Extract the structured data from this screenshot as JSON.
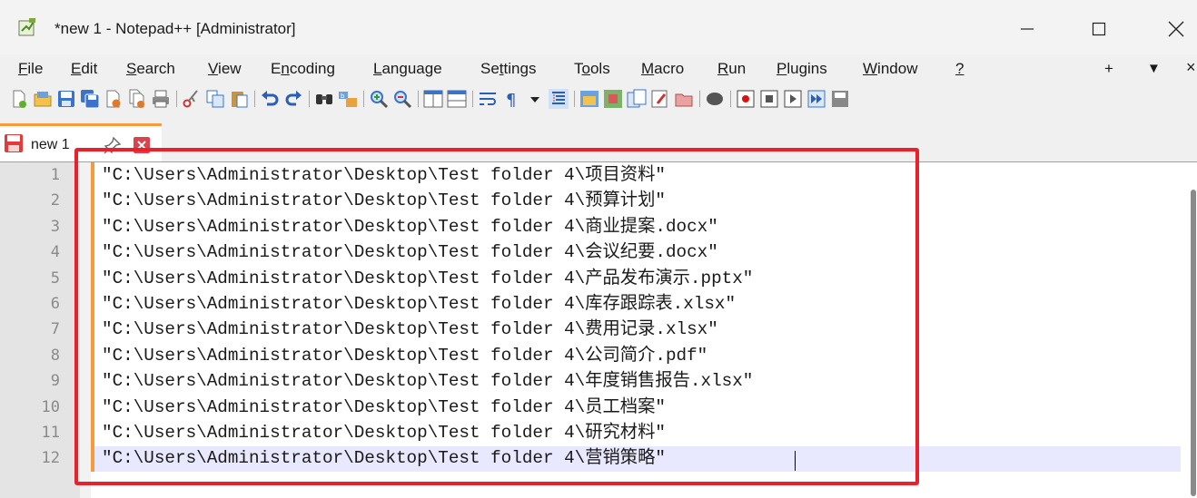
{
  "window": {
    "title": "*new 1 - Notepad++ [Administrator]",
    "icons": [
      "app-icon",
      "minimize-icon",
      "maximize-icon",
      "close-icon"
    ]
  },
  "menubar": {
    "items": [
      {
        "pre": "",
        "key": "F",
        "post": "ile"
      },
      {
        "pre": "",
        "key": "E",
        "post": "dit"
      },
      {
        "pre": "",
        "key": "S",
        "post": "earch"
      },
      {
        "pre": "",
        "key": "V",
        "post": "iew"
      },
      {
        "pre": "E",
        "key": "n",
        "post": "coding"
      },
      {
        "pre": "",
        "key": "L",
        "post": "anguage"
      },
      {
        "pre": "Se",
        "key": "t",
        "post": "tings"
      },
      {
        "pre": "T",
        "key": "o",
        "post": "ols"
      },
      {
        "pre": "",
        "key": "M",
        "post": "acro"
      },
      {
        "pre": "",
        "key": "R",
        "post": "un"
      },
      {
        "pre": "",
        "key": "P",
        "post": "lugins"
      },
      {
        "pre": "",
        "key": "W",
        "post": "indow"
      },
      {
        "pre": "",
        "key": "?",
        "post": ""
      }
    ],
    "right": {
      "plus": "+",
      "down": "▼",
      "close": "×"
    }
  },
  "toolbar": {
    "buttons": [
      "new-file-icon",
      "open-file-icon",
      "save-icon",
      "save-all-icon",
      "close-file-icon",
      "close-all-icon",
      "print-icon",
      "cut-icon",
      "copy-icon",
      "paste-icon",
      "undo-icon",
      "redo-icon",
      "find-icon",
      "replace-icon",
      "zoom-in-icon",
      "zoom-out-icon",
      "sync-vertical-icon",
      "sync-horizontal-icon",
      "word-wrap-icon",
      "show-all-chars-icon",
      "dropdown-icon",
      "indent-guide-icon",
      "user-lang-icon",
      "doc-map-icon",
      "function-list-icon",
      "folder-workspace-icon",
      "folder-icon",
      "monitoring-icon",
      "record-macro-icon",
      "stop-record-icon",
      "play-macro-icon",
      "run-macro-multiple-icon",
      "save-macro-icon"
    ]
  },
  "tab": {
    "label": "new 1",
    "icons": [
      "save-status-icon",
      "pin-icon",
      "close-tab-icon"
    ]
  },
  "editor": {
    "lines": [
      {
        "num": "1",
        "text": "\"C:\\Users\\Administrator\\Desktop\\Test folder 4\\项目资料\""
      },
      {
        "num": "2",
        "text": "\"C:\\Users\\Administrator\\Desktop\\Test folder 4\\预算计划\""
      },
      {
        "num": "3",
        "text": "\"C:\\Users\\Administrator\\Desktop\\Test folder 4\\商业提案.docx\""
      },
      {
        "num": "4",
        "text": "\"C:\\Users\\Administrator\\Desktop\\Test folder 4\\会议纪要.docx\""
      },
      {
        "num": "5",
        "text": "\"C:\\Users\\Administrator\\Desktop\\Test folder 4\\产品发布演示.pptx\""
      },
      {
        "num": "6",
        "text": "\"C:\\Users\\Administrator\\Desktop\\Test folder 4\\库存跟踪表.xlsx\""
      },
      {
        "num": "7",
        "text": "\"C:\\Users\\Administrator\\Desktop\\Test folder 4\\费用记录.xlsx\""
      },
      {
        "num": "8",
        "text": "\"C:\\Users\\Administrator\\Desktop\\Test folder 4\\公司简介.pdf\""
      },
      {
        "num": "9",
        "text": "\"C:\\Users\\Administrator\\Desktop\\Test folder 4\\年度销售报告.xlsx\""
      },
      {
        "num": "10",
        "text": "\"C:\\Users\\Administrator\\Desktop\\Test folder 4\\员工档案\""
      },
      {
        "num": "11",
        "text": "\"C:\\Users\\Administrator\\Desktop\\Test folder 4\\研究材料\""
      },
      {
        "num": "12",
        "text": "\"C:\\Users\\Administrator\\Desktop\\Test folder 4\\营销策略\""
      }
    ]
  },
  "colors": {
    "highlight_border": "#e8212a",
    "change_bar": "#f59b3c",
    "current_line": "#e8e8ff"
  }
}
